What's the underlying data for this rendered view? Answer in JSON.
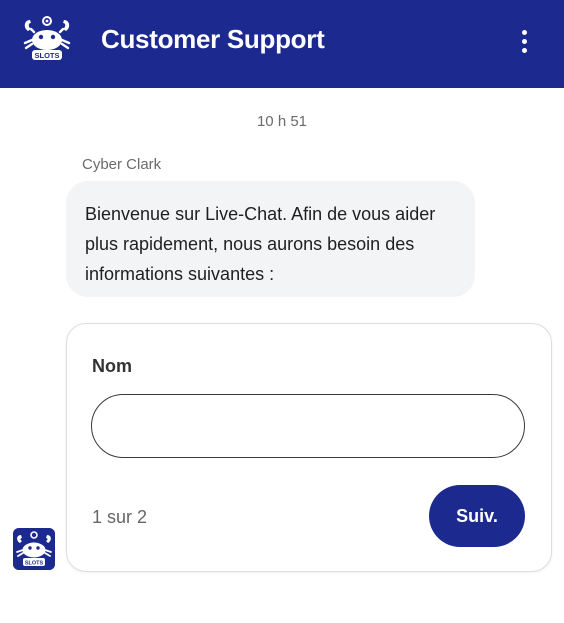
{
  "header": {
    "title": "Customer Support",
    "logo_text": "SLOTS",
    "menu_icon": "kebab-menu-icon"
  },
  "chat": {
    "timestamp": "10 h 51",
    "sender_name": "Cyber Clark",
    "message": "Bienvenue sur Live-Chat. Afin de vous aider plus rapidement, nous aurons besoin des informations suivantes :"
  },
  "form": {
    "field_label": "Nom",
    "field_value": "",
    "field_placeholder": "",
    "step_text": "1 sur 2",
    "next_label": "Suiv."
  },
  "colors": {
    "brand": "#1c2a8f",
    "bubble": "#f3f4f6",
    "header_text": "#ffffff"
  }
}
